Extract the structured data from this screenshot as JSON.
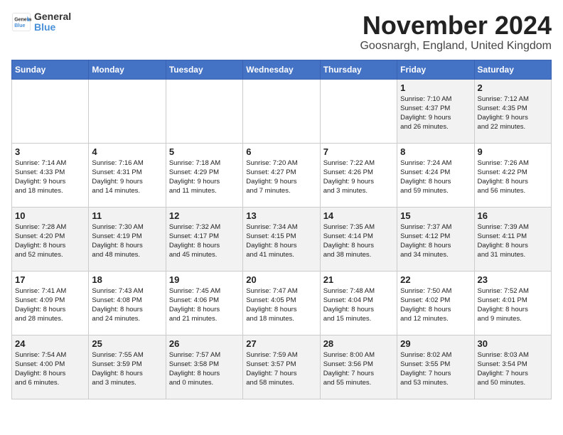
{
  "header": {
    "logo_general": "General",
    "logo_blue": "Blue",
    "month_title": "November 2024",
    "location": "Goosnargh, England, United Kingdom"
  },
  "days_of_week": [
    "Sunday",
    "Monday",
    "Tuesday",
    "Wednesday",
    "Thursday",
    "Friday",
    "Saturday"
  ],
  "weeks": [
    [
      {
        "day": "",
        "text": ""
      },
      {
        "day": "",
        "text": ""
      },
      {
        "day": "",
        "text": ""
      },
      {
        "day": "",
        "text": ""
      },
      {
        "day": "",
        "text": ""
      },
      {
        "day": "1",
        "text": "Sunrise: 7:10 AM\nSunset: 4:37 PM\nDaylight: 9 hours\nand 26 minutes."
      },
      {
        "day": "2",
        "text": "Sunrise: 7:12 AM\nSunset: 4:35 PM\nDaylight: 9 hours\nand 22 minutes."
      }
    ],
    [
      {
        "day": "3",
        "text": "Sunrise: 7:14 AM\nSunset: 4:33 PM\nDaylight: 9 hours\nand 18 minutes."
      },
      {
        "day": "4",
        "text": "Sunrise: 7:16 AM\nSunset: 4:31 PM\nDaylight: 9 hours\nand 14 minutes."
      },
      {
        "day": "5",
        "text": "Sunrise: 7:18 AM\nSunset: 4:29 PM\nDaylight: 9 hours\nand 11 minutes."
      },
      {
        "day": "6",
        "text": "Sunrise: 7:20 AM\nSunset: 4:27 PM\nDaylight: 9 hours\nand 7 minutes."
      },
      {
        "day": "7",
        "text": "Sunrise: 7:22 AM\nSunset: 4:26 PM\nDaylight: 9 hours\nand 3 minutes."
      },
      {
        "day": "8",
        "text": "Sunrise: 7:24 AM\nSunset: 4:24 PM\nDaylight: 8 hours\nand 59 minutes."
      },
      {
        "day": "9",
        "text": "Sunrise: 7:26 AM\nSunset: 4:22 PM\nDaylight: 8 hours\nand 56 minutes."
      }
    ],
    [
      {
        "day": "10",
        "text": "Sunrise: 7:28 AM\nSunset: 4:20 PM\nDaylight: 8 hours\nand 52 minutes."
      },
      {
        "day": "11",
        "text": "Sunrise: 7:30 AM\nSunset: 4:19 PM\nDaylight: 8 hours\nand 48 minutes."
      },
      {
        "day": "12",
        "text": "Sunrise: 7:32 AM\nSunset: 4:17 PM\nDaylight: 8 hours\nand 45 minutes."
      },
      {
        "day": "13",
        "text": "Sunrise: 7:34 AM\nSunset: 4:15 PM\nDaylight: 8 hours\nand 41 minutes."
      },
      {
        "day": "14",
        "text": "Sunrise: 7:35 AM\nSunset: 4:14 PM\nDaylight: 8 hours\nand 38 minutes."
      },
      {
        "day": "15",
        "text": "Sunrise: 7:37 AM\nSunset: 4:12 PM\nDaylight: 8 hours\nand 34 minutes."
      },
      {
        "day": "16",
        "text": "Sunrise: 7:39 AM\nSunset: 4:11 PM\nDaylight: 8 hours\nand 31 minutes."
      }
    ],
    [
      {
        "day": "17",
        "text": "Sunrise: 7:41 AM\nSunset: 4:09 PM\nDaylight: 8 hours\nand 28 minutes."
      },
      {
        "day": "18",
        "text": "Sunrise: 7:43 AM\nSunset: 4:08 PM\nDaylight: 8 hours\nand 24 minutes."
      },
      {
        "day": "19",
        "text": "Sunrise: 7:45 AM\nSunset: 4:06 PM\nDaylight: 8 hours\nand 21 minutes."
      },
      {
        "day": "20",
        "text": "Sunrise: 7:47 AM\nSunset: 4:05 PM\nDaylight: 8 hours\nand 18 minutes."
      },
      {
        "day": "21",
        "text": "Sunrise: 7:48 AM\nSunset: 4:04 PM\nDaylight: 8 hours\nand 15 minutes."
      },
      {
        "day": "22",
        "text": "Sunrise: 7:50 AM\nSunset: 4:02 PM\nDaylight: 8 hours\nand 12 minutes."
      },
      {
        "day": "23",
        "text": "Sunrise: 7:52 AM\nSunset: 4:01 PM\nDaylight: 8 hours\nand 9 minutes."
      }
    ],
    [
      {
        "day": "24",
        "text": "Sunrise: 7:54 AM\nSunset: 4:00 PM\nDaylight: 8 hours\nand 6 minutes."
      },
      {
        "day": "25",
        "text": "Sunrise: 7:55 AM\nSunset: 3:59 PM\nDaylight: 8 hours\nand 3 minutes."
      },
      {
        "day": "26",
        "text": "Sunrise: 7:57 AM\nSunset: 3:58 PM\nDaylight: 8 hours\nand 0 minutes."
      },
      {
        "day": "27",
        "text": "Sunrise: 7:59 AM\nSunset: 3:57 PM\nDaylight: 7 hours\nand 58 minutes."
      },
      {
        "day": "28",
        "text": "Sunrise: 8:00 AM\nSunset: 3:56 PM\nDaylight: 7 hours\nand 55 minutes."
      },
      {
        "day": "29",
        "text": "Sunrise: 8:02 AM\nSunset: 3:55 PM\nDaylight: 7 hours\nand 53 minutes."
      },
      {
        "day": "30",
        "text": "Sunrise: 8:03 AM\nSunset: 3:54 PM\nDaylight: 7 hours\nand 50 minutes."
      }
    ]
  ]
}
